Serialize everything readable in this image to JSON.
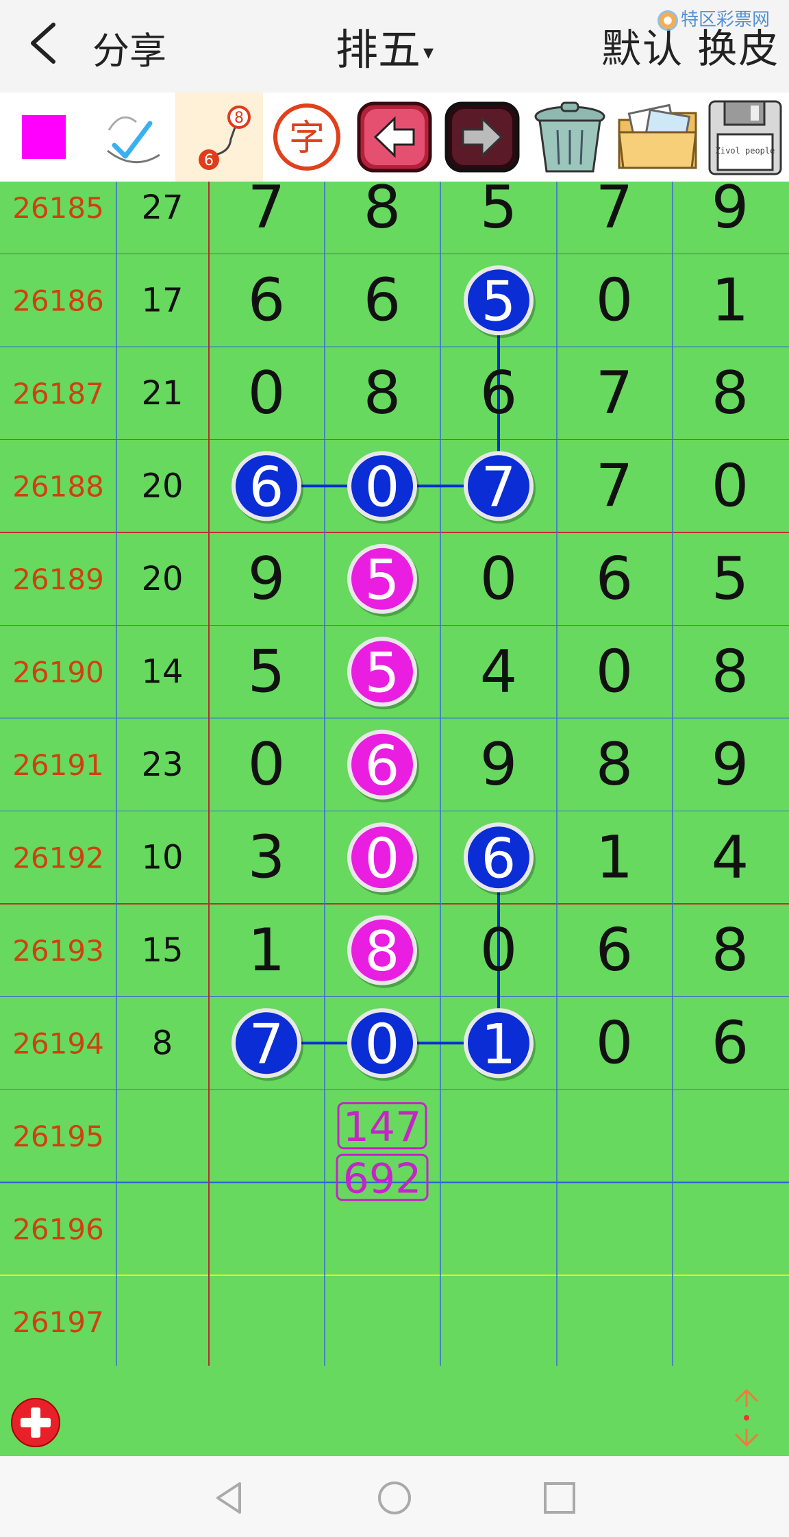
{
  "header": {
    "back_icon": "chevron-left-icon",
    "share_label": "分享",
    "title": "排五",
    "title_caret": "▾",
    "skin_label": "默认 换皮",
    "watermark": "特区彩票网"
  },
  "toolbar": {
    "items": [
      {
        "name": "color-swatch-icon",
        "color": "#ff00ff"
      },
      {
        "name": "pen-draw-icon"
      },
      {
        "name": "connect-line-icon",
        "top_num": "8",
        "bottom_num": "6"
      },
      {
        "name": "text-char-icon",
        "char": "字"
      },
      {
        "name": "undo-arrow-icon"
      },
      {
        "name": "redo-arrow-icon"
      },
      {
        "name": "trash-icon"
      },
      {
        "name": "image-folder-icon"
      },
      {
        "name": "save-floppy-icon",
        "label": "Zivol people"
      }
    ]
  },
  "colors": {
    "grid_bg": "#66d95e",
    "issue_text": "#d0400e",
    "blue_ball": "#0a2dd6",
    "magenta_ball": "#ea1ee0",
    "note_color": "#c822c8"
  },
  "table": {
    "rows": [
      {
        "issue": "26185",
        "sum": "27",
        "digits": [
          "7",
          "8",
          "5",
          "7",
          "9"
        ]
      },
      {
        "issue": "26186",
        "sum": "17",
        "digits": [
          "6",
          "6",
          "5",
          "0",
          "1"
        ]
      },
      {
        "issue": "26187",
        "sum": "21",
        "digits": [
          "0",
          "8",
          "6",
          "7",
          "8"
        ]
      },
      {
        "issue": "26188",
        "sum": "20",
        "digits": [
          "6",
          "0",
          "7",
          "7",
          "0"
        ]
      },
      {
        "issue": "26189",
        "sum": "20",
        "digits": [
          "9",
          "5",
          "0",
          "6",
          "5"
        ]
      },
      {
        "issue": "26190",
        "sum": "14",
        "digits": [
          "5",
          "5",
          "4",
          "0",
          "8"
        ]
      },
      {
        "issue": "26191",
        "sum": "23",
        "digits": [
          "0",
          "6",
          "9",
          "8",
          "9"
        ]
      },
      {
        "issue": "26192",
        "sum": "10",
        "digits": [
          "3",
          "0",
          "6",
          "1",
          "4"
        ]
      },
      {
        "issue": "26193",
        "sum": "15",
        "digits": [
          "1",
          "8",
          "0",
          "6",
          "8"
        ]
      },
      {
        "issue": "26194",
        "sum": "8",
        "digits": [
          "7",
          "0",
          "1",
          "0",
          "6"
        ]
      },
      {
        "issue": "26195",
        "sum": "",
        "digits": [
          "",
          "",
          "",
          "",
          ""
        ]
      },
      {
        "issue": "26196",
        "sum": "",
        "digits": [
          "",
          "",
          "",
          "",
          ""
        ]
      },
      {
        "issue": "26197",
        "sum": "",
        "digits": [
          "",
          "",
          "",
          "",
          ""
        ]
      }
    ],
    "blue_marks": [
      [
        1,
        2
      ],
      [
        3,
        0
      ],
      [
        3,
        1
      ],
      [
        3,
        2
      ],
      [
        7,
        2
      ],
      [
        9,
        0
      ],
      [
        9,
        1
      ],
      [
        9,
        2
      ]
    ],
    "magenta_marks": [
      [
        4,
        1
      ],
      [
        5,
        1
      ],
      [
        6,
        1
      ],
      [
        7,
        1
      ],
      [
        8,
        1
      ]
    ],
    "blue_lines": [
      [
        [
          1,
          2
        ],
        [
          3,
          2
        ]
      ],
      [
        [
          3,
          0
        ],
        [
          3,
          2
        ]
      ],
      [
        [
          7,
          2
        ],
        [
          9,
          2
        ]
      ],
      [
        [
          9,
          0
        ],
        [
          9,
          2
        ]
      ]
    ],
    "notes": [
      {
        "text": "147",
        "row": 10,
        "col": 1
      },
      {
        "text": "692",
        "row": 11,
        "col": 1
      }
    ]
  },
  "footer": {
    "add_icon": "add-circle-icon",
    "scroll_icon": "up-down-arrows-icon"
  },
  "nav": {
    "back": "nav-back-icon",
    "home": "nav-home-icon",
    "recent": "nav-recent-icon"
  }
}
